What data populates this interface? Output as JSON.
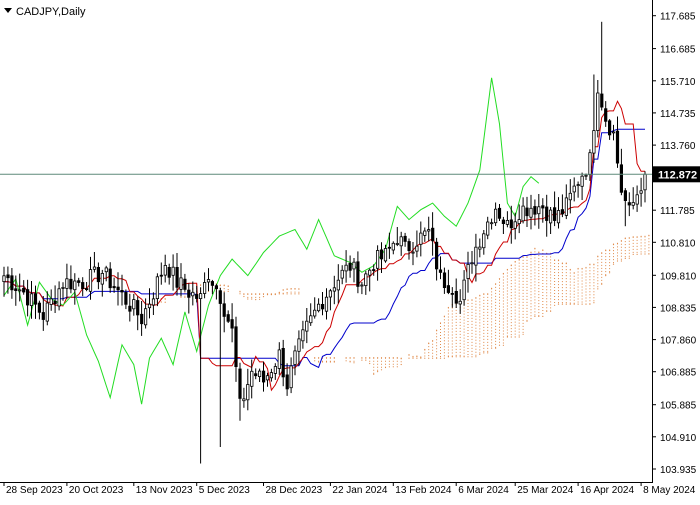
{
  "chart_data": {
    "type": "candlestick",
    "symbol_label": "CADJPY,Daily",
    "timeframe": "Daily",
    "indicator": "Ichimoku Kinko Hyo",
    "current_price": 112.872,
    "y_axis": {
      "ylim": [
        103.6,
        118.1
      ],
      "tick_labels": [
        "117.685",
        "116.685",
        "115.710",
        "114.735",
        "113.760",
        "112.785",
        "111.785",
        "110.810",
        "109.810",
        "108.835",
        "107.860",
        "106.885",
        "105.885",
        "104.910",
        "103.935"
      ],
      "price_badge": "112.872"
    },
    "x_axis": {
      "tick_labels": [
        "28 Sep 2023",
        "20 Oct 2023",
        "13 Nov 2023",
        "5 Dec 2023",
        "28 Dec 2023",
        "22 Jan 2024",
        "13 Feb 2024",
        "6 Mar 2024",
        "25 Mar 2024",
        "16 Apr 2024",
        "8 May 2024"
      ]
    },
    "series_visual": [
      {
        "key": "candles",
        "color": "#000000"
      },
      {
        "key": "tenkan_sen",
        "color": "#cc0000"
      },
      {
        "key": "kijun_sen",
        "color": "#0000cc"
      },
      {
        "key": "chikou_span",
        "color": "#22dd22"
      },
      {
        "key": "kumo_cloud",
        "color": "#e08a4a"
      }
    ],
    "colors": {
      "background": "#ffffff",
      "axis": "#000000",
      "price_line": "#5f8a7a",
      "badge_bg": "#000000",
      "badge_text": "#ffffff"
    },
    "candle_anchors": [
      [
        0,
        109.8
      ],
      [
        5,
        109.3
      ],
      [
        10,
        108.6
      ],
      [
        15,
        109.6
      ],
      [
        20,
        109.6
      ],
      [
        25,
        109.9
      ],
      [
        30,
        109.2
      ],
      [
        35,
        108.5
      ],
      [
        38,
        109.3
      ],
      [
        41,
        110.2
      ],
      [
        44,
        109.6
      ],
      [
        47,
        109.3
      ],
      [
        50,
        109.1
      ],
      [
        52,
        109.9
      ],
      [
        55,
        109.2
      ],
      [
        58,
        108.1
      ],
      [
        60,
        105.8
      ],
      [
        63,
        106.9
      ],
      [
        66,
        106.6
      ],
      [
        70,
        107.4
      ],
      [
        72,
        106.5
      ],
      [
        74,
        107.3
      ],
      [
        77,
        108.2
      ],
      [
        80,
        108.9
      ],
      [
        84,
        109.6
      ],
      [
        88,
        110.1
      ],
      [
        91,
        109.6
      ],
      [
        94,
        110.2
      ],
      [
        97,
        110.4
      ],
      [
        100,
        111.0
      ],
      [
        102,
        110.6
      ],
      [
        105,
        110.9
      ],
      [
        108,
        111.1
      ],
      [
        111,
        109.7
      ],
      [
        114,
        109.5
      ],
      [
        116,
        109.0
      ],
      [
        119,
        110.4
      ],
      [
        122,
        111.2
      ],
      [
        125,
        111.9
      ],
      [
        128,
        111.3
      ],
      [
        131,
        111.8
      ],
      [
        134,
        111.9
      ],
      [
        137,
        111.9
      ],
      [
        140,
        111.5
      ],
      [
        143,
        111.9
      ],
      [
        146,
        112.7
      ],
      [
        149,
        113.3
      ],
      [
        151,
        115.6
      ],
      [
        153,
        114.6
      ],
      [
        155,
        114.1
      ],
      [
        157,
        112.4
      ],
      [
        159,
        111.7
      ],
      [
        161,
        112.3
      ],
      [
        163,
        112.9
      ]
    ],
    "chikou_anchors": [
      [
        0,
        109.2
      ],
      [
        3,
        109.7
      ],
      [
        6,
        108.3
      ],
      [
        9,
        109.6
      ],
      [
        12,
        109.1
      ],
      [
        15,
        108.9
      ],
      [
        18,
        109.3
      ],
      [
        21,
        108.0
      ],
      [
        24,
        107.2
      ],
      [
        27,
        106.1
      ],
      [
        30,
        107.7
      ],
      [
        33,
        107.1
      ],
      [
        35,
        105.9
      ],
      [
        37,
        107.3
      ],
      [
        40,
        107.9
      ],
      [
        43,
        107.1
      ],
      [
        46,
        108.7
      ],
      [
        49,
        107.5
      ],
      [
        52,
        108.9
      ],
      [
        55,
        109.8
      ],
      [
        58,
        110.3
      ],
      [
        62,
        109.8
      ],
      [
        66,
        110.5
      ],
      [
        70,
        111.0
      ],
      [
        74,
        111.2
      ],
      [
        77,
        110.6
      ],
      [
        80,
        111.5
      ],
      [
        84,
        110.4
      ],
      [
        88,
        110.2
      ],
      [
        91,
        109.9
      ],
      [
        94,
        110.1
      ],
      [
        97,
        110.6
      ],
      [
        100,
        111.9
      ],
      [
        103,
        111.5
      ],
      [
        106,
        111.8
      ],
      [
        109,
        112.0
      ],
      [
        112,
        111.6
      ],
      [
        115,
        111.3
      ],
      [
        118,
        112.0
      ],
      [
        121,
        113.0
      ],
      [
        124,
        115.8
      ],
      [
        126,
        114.4
      ],
      [
        128,
        112.0
      ],
      [
        130,
        111.6
      ],
      [
        132,
        112.5
      ],
      [
        134,
        112.8
      ],
      [
        136,
        112.6
      ]
    ]
  }
}
